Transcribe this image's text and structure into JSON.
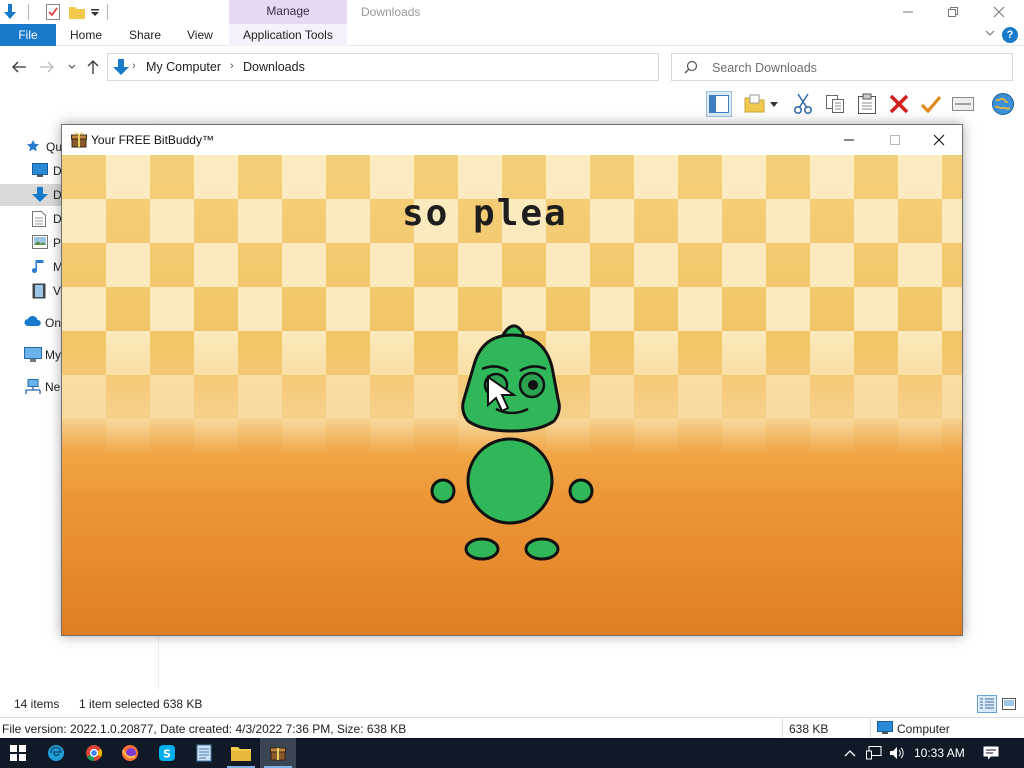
{
  "explorer": {
    "title": "Downloads",
    "manage_tab": "Manage",
    "tabs": {
      "file": "File",
      "home": "Home",
      "share": "Share",
      "view": "View",
      "app_tools": "Application Tools"
    },
    "breadcrumb": [
      "My Computer",
      "Downloads"
    ],
    "search_placeholder": "Search Downloads",
    "nav_items": [
      {
        "label": "Qu",
        "icon": "star-icon"
      },
      {
        "label": "D",
        "icon": "desktop-icon"
      },
      {
        "label": "D",
        "icon": "downloads-icon"
      },
      {
        "label": "D",
        "icon": "document-icon"
      },
      {
        "label": "Pi",
        "icon": "pictures-icon"
      },
      {
        "label": "M",
        "icon": "music-icon"
      },
      {
        "label": "Vi",
        "icon": "video-icon"
      },
      {
        "label": "On",
        "icon": "cloud-icon"
      },
      {
        "label": "My",
        "icon": "computer-icon"
      },
      {
        "label": "Ne",
        "icon": "network-icon"
      }
    ],
    "status": {
      "items": "14 items",
      "selected": "1 item selected  638 KB"
    },
    "details": {
      "file_info": "File version: 2022.1.0.20877, Date created: 4/3/2022 7:36 PM, Size: 638 KB",
      "size": "638 KB",
      "location": "Computer"
    },
    "help": "?"
  },
  "bitbuddy": {
    "title": "Your FREE BitBuddy™",
    "speech": "so plea"
  },
  "taskbar": {
    "time": "10:33 AM"
  },
  "colors": {
    "accent": "#1979ca",
    "buddy_green": "#2fb75a",
    "manage": "#e6d9f2"
  }
}
